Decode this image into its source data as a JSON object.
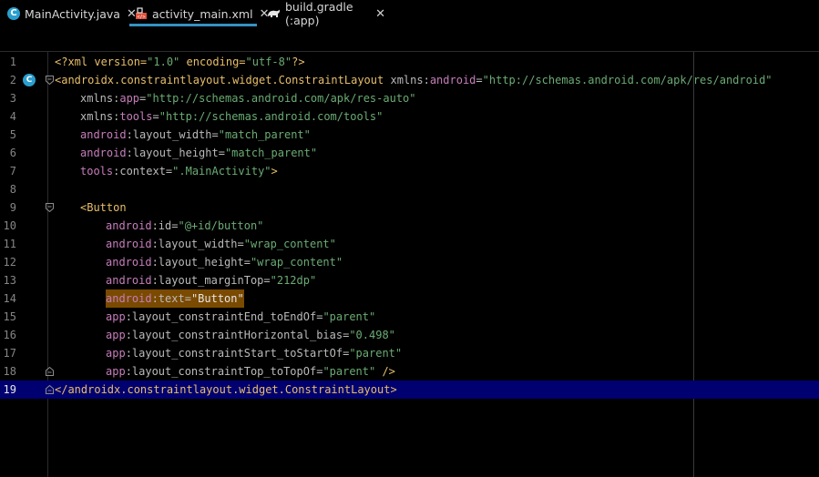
{
  "tabs": [
    {
      "label": "MainActivity.java",
      "icon": "java-class-icon",
      "active": false
    },
    {
      "label": "activity_main.xml",
      "icon": "xml-layout-icon",
      "active": true
    },
    {
      "label": "build.gradle (:app)",
      "icon": "gradle-icon",
      "active": false
    }
  ],
  "close_glyph": "✕",
  "gutter": {
    "marker_letter": "C"
  },
  "colors": {
    "tag": "#e8bf6a",
    "namespace": "#c77dbb",
    "attribute": "#bababa",
    "value": "#6aab73",
    "current_line": "#000070",
    "tab_underline": "#3592c4",
    "highlight": "#7a4a00"
  },
  "lines": [
    {
      "num": "1"
    },
    {
      "num": "2"
    },
    {
      "num": "3"
    },
    {
      "num": "4"
    },
    {
      "num": "5"
    },
    {
      "num": "6"
    },
    {
      "num": "7"
    },
    {
      "num": "8"
    },
    {
      "num": "9"
    },
    {
      "num": "10"
    },
    {
      "num": "11"
    },
    {
      "num": "12"
    },
    {
      "num": "13"
    },
    {
      "num": "14"
    },
    {
      "num": "15"
    },
    {
      "num": "16"
    },
    {
      "num": "17"
    },
    {
      "num": "18"
    },
    {
      "num": "19"
    }
  ],
  "code": {
    "l1": {
      "a": "<?xml version=",
      "b": "\"1.0\"",
      "c": " encoding=",
      "d": "\"utf-8\"",
      "e": "?>"
    },
    "l2": {
      "a": "<androidx.constraintlayout.widget.ConstraintLayout ",
      "b": "xmlns:",
      "c": "android",
      "d": "=",
      "e": "\"http://schemas.android.com/apk/res/android\""
    },
    "l3": {
      "a": "xmlns:",
      "b": "app",
      "c": "=",
      "d": "\"http://schemas.android.com/apk/res-auto\""
    },
    "l4": {
      "a": "xmlns:",
      "b": "tools",
      "c": "=",
      "d": "\"http://schemas.android.com/tools\""
    },
    "l5": {
      "a": "android",
      "b": ":layout_width=",
      "c": "\"match_parent\""
    },
    "l6": {
      "a": "android",
      "b": ":layout_height=",
      "c": "\"match_parent\""
    },
    "l7": {
      "a": "tools",
      "b": ":context=",
      "c": "\".MainActivity\"",
      "d": ">"
    },
    "l9": {
      "a": "<Button"
    },
    "l10": {
      "a": "android",
      "b": ":id=",
      "c": "\"@+id/button\""
    },
    "l11": {
      "a": "android",
      "b": ":layout_width=",
      "c": "\"wrap_content\""
    },
    "l12": {
      "a": "android",
      "b": ":layout_height=",
      "c": "\"wrap_content\""
    },
    "l13": {
      "a": "android",
      "b": ":layout_marginTop=",
      "c": "\"212dp\""
    },
    "l14": {
      "a": "android",
      "b": ":text=",
      "c": "\"Button\""
    },
    "l15": {
      "a": "app",
      "b": ":layout_constraintEnd_toEndOf=",
      "c": "\"parent\""
    },
    "l16": {
      "a": "app",
      "b": ":layout_constraintHorizontal_bias=",
      "c": "\"0.498\""
    },
    "l17": {
      "a": "app",
      "b": ":layout_constraintStart_toStartOf=",
      "c": "\"parent\""
    },
    "l18": {
      "a": "app",
      "b": ":layout_constraintTop_toTopOf=",
      "c": "\"parent\"",
      "d": " />"
    },
    "l19": {
      "a": "</androidx.constraintlayout.widget.ConstraintLayout>"
    }
  }
}
